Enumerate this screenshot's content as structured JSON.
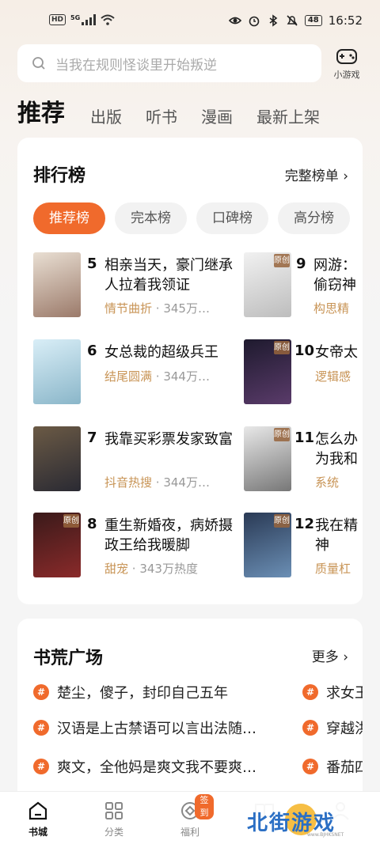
{
  "status_bar": {
    "hd": "HD",
    "network": "5G",
    "battery": "48",
    "time": "16:52"
  },
  "search": {
    "placeholder": "当我在规则怪谈里开始叛逆"
  },
  "game": {
    "label": "小游戏"
  },
  "top_tabs": [
    "推荐",
    "出版",
    "听书",
    "漫画",
    "最新上架"
  ],
  "ranking": {
    "title": "排行榜",
    "more": "完整榜单",
    "pills": [
      "推荐榜",
      "完本榜",
      "口碑榜",
      "高分榜"
    ],
    "books_left": [
      {
        "rank": "5",
        "title": "相亲当天，豪门继承人拉着我领证",
        "cat": "情节曲折",
        "heat": "345万…",
        "cover": [
          "#e9dfd3",
          "#9b7a6a"
        ],
        "tag": ""
      },
      {
        "rank": "6",
        "title": "女总裁的超级兵王",
        "cat": "结尾圆满",
        "heat": "344万…",
        "cover": [
          "#d9eef7",
          "#8ab6c9"
        ],
        "tag": ""
      },
      {
        "rank": "7",
        "title": "我靠买彩票发家致富",
        "cat": "抖音热搜",
        "heat": "344万…",
        "cover": [
          "#6b5a45",
          "#2a2a33"
        ],
        "tag": ""
      },
      {
        "rank": "8",
        "title": "重生新婚夜，病娇摄政王给我暖脚",
        "cat": "甜宠",
        "heat": "343万热度",
        "cover": [
          "#3a1a1a",
          "#8a2a2a"
        ],
        "tag": "原创"
      }
    ],
    "books_right": [
      {
        "rank": "9",
        "title": "网游：偷窃神",
        "cat": "构思精",
        "cover": [
          "#f1f1f1",
          "#bdbdbd"
        ],
        "tag": "原创"
      },
      {
        "rank": "10",
        "title": "女帝太",
        "cat": "逻辑感",
        "cover": [
          "#1e1a2e",
          "#5a3b6a"
        ],
        "tag": "原创"
      },
      {
        "rank": "11",
        "title": "怎么办为我和",
        "cat": "系统",
        "cover": [
          "#e8e8e8",
          "#777777"
        ],
        "tag": "原创"
      },
      {
        "rank": "12",
        "title": "我在精神",
        "cat": "质量杠",
        "cover": [
          "#2a3a55",
          "#6b8fb5"
        ],
        "tag": "原创"
      }
    ]
  },
  "forum": {
    "title": "书荒广场",
    "more": "更多",
    "topics_left": [
      "楚尘，傻子，封印自己五年",
      "汉语是上古禁语可以言出法随…",
      "爽文，全他妈是爽文我不要爽…"
    ],
    "topics_right": [
      "求女王",
      "穿越洪",
      "番茄四"
    ]
  },
  "bottom_nav": {
    "items": [
      "书城",
      "分类",
      "福利",
      "",
      ""
    ],
    "sign_badge": "签到"
  },
  "watermark": {
    "text": "北街游戏",
    "small": "www.BJHKSNET"
  },
  "colors": {
    "accent": "#f06a2c",
    "category": "#c89456"
  }
}
